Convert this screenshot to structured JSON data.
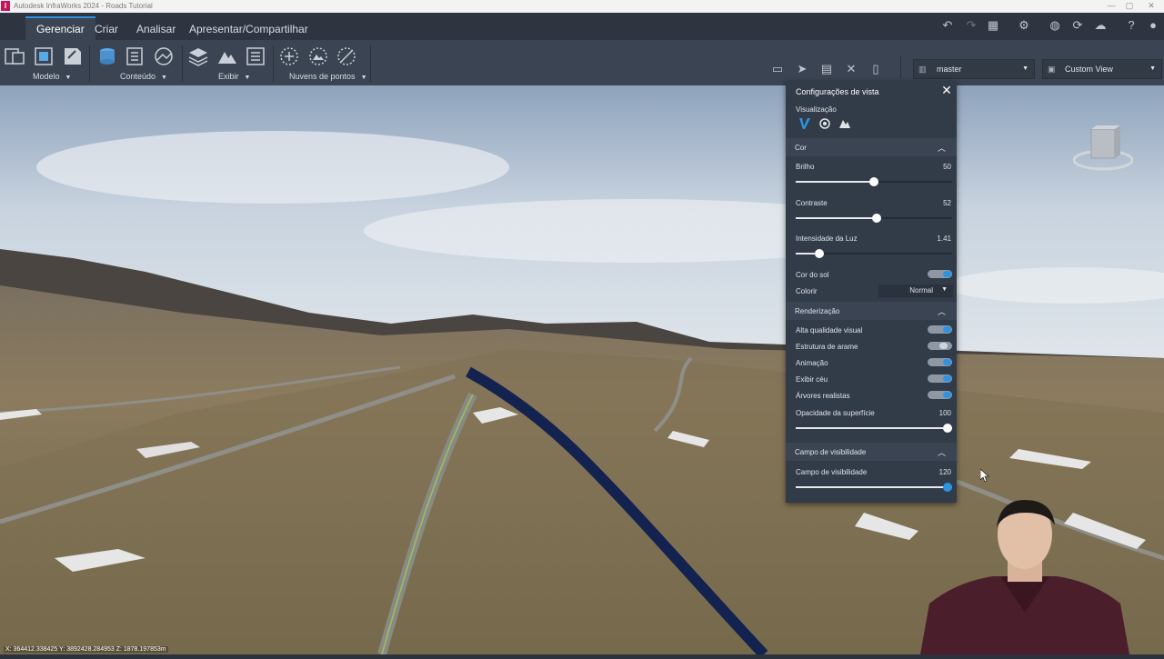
{
  "window": {
    "app_badge": "I",
    "title": "Autodesk InfraWorks 2024 - Roads Tutorial",
    "minimize": "—",
    "maximize": "▢",
    "close": "✕"
  },
  "ribbon_tabs": [
    {
      "label": "Gerenciar",
      "active": true
    },
    {
      "label": "Criar",
      "active": false
    },
    {
      "label": "Analisar",
      "active": false
    },
    {
      "label": "Apresentar/Compartilhar",
      "active": false
    }
  ],
  "ribbon_groups": {
    "modelo": "Modelo",
    "conteudo": "Conteúdo",
    "exibir": "Exibir",
    "nuvens": "Nuvens de pontos"
  },
  "top_icons": [
    "undo-icon",
    "redo-icon",
    "calculator-icon",
    "gear-icon",
    "globe-icon",
    "refresh-icon",
    "cloud-icon",
    "help-icon",
    "profile-icon"
  ],
  "toolbar": {
    "proposal": "master",
    "view": "Custom View"
  },
  "viewport": {
    "coordinates": "X: 364412.338425 Y: 3892428.284953 Z: 1878.197853m"
  },
  "panel": {
    "title": "Configurações de vista",
    "visualization_label": "Visualização",
    "sections": {
      "cor": "Cor",
      "renderizacao": "Renderização",
      "campo": "Campo de visibilidade"
    },
    "brilho": {
      "label": "Brilho",
      "value": "50",
      "fraction": 0.5
    },
    "contraste": {
      "label": "Contraste",
      "value": "52",
      "fraction": 0.52
    },
    "intensidade": {
      "label": "Intensidade da Luz",
      "value": "1.41",
      "fraction": 0.15
    },
    "cor_do_sol": {
      "label": "Cor do sol",
      "on": true
    },
    "colorir": {
      "label": "Colorir",
      "value": "Normal"
    },
    "toggles": [
      {
        "label": "Alta qualidade visual",
        "on": true
      },
      {
        "label": "Estrutura de arame",
        "on": false
      },
      {
        "label": "Animação",
        "on": true
      },
      {
        "label": "Exibir céu",
        "on": true
      },
      {
        "label": "Árvores realistas",
        "on": true
      }
    ],
    "opacidade": {
      "label": "Opacidade da superfície",
      "value": "100",
      "fraction": 1.0
    },
    "campo": {
      "label": "Campo de visibilidade",
      "value": "120",
      "fraction": 1.0
    }
  },
  "colors": {
    "accent": "#2c95e3",
    "panel_bg": "#323b48",
    "road_blue": "#13224f"
  }
}
